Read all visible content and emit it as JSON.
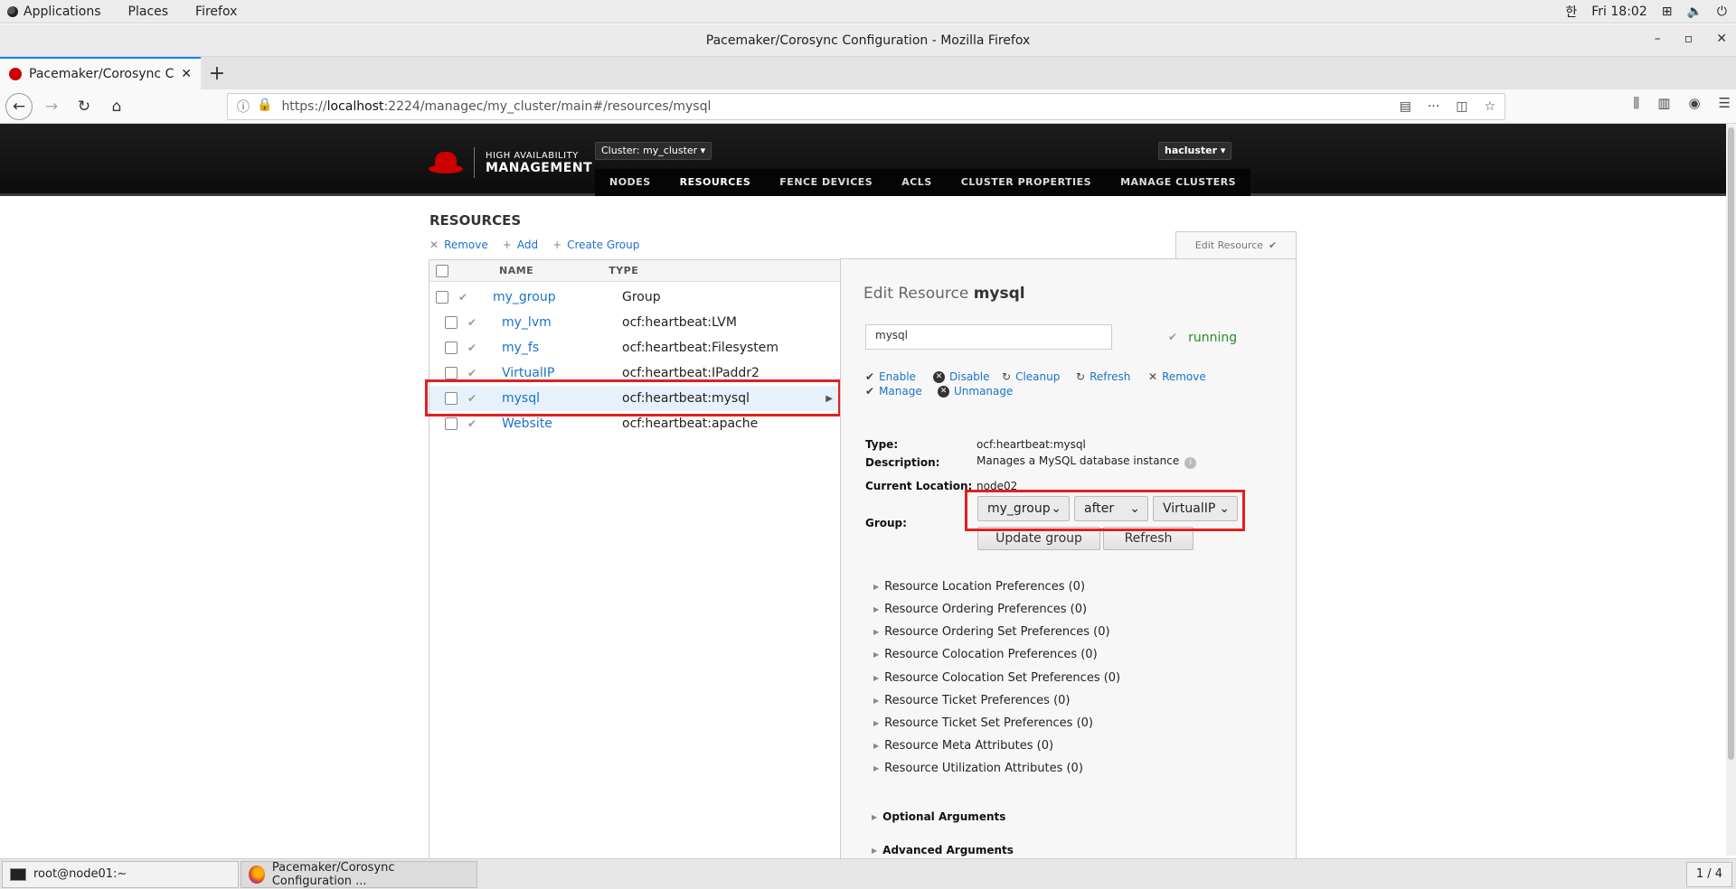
{
  "gnome": {
    "applications": "Applications",
    "places": "Places",
    "firefox": "Firefox",
    "input_method": "한",
    "clock": "Fri 18:02"
  },
  "window": {
    "title": "Pacemaker/Corosync Configuration - Mozilla Firefox"
  },
  "tab": {
    "title": "Pacemaker/Corosync Con",
    "new_tab": "+"
  },
  "urlbar": {
    "prefix": "https://",
    "host": "localhost",
    "rest": ":2224/managec/my_cluster/main#/resources/mysql"
  },
  "header": {
    "logo_line1": "HIGH AVAILABILITY",
    "logo_line2": "MANAGEMENT",
    "cluster_dropdown": "Cluster: my_cluster ▾",
    "user_dropdown": "hacluster ▾",
    "nav": [
      {
        "label": "NODES"
      },
      {
        "label": "RESOURCES"
      },
      {
        "label": "FENCE DEVICES"
      },
      {
        "label": "ACLS"
      },
      {
        "label": "CLUSTER PROPERTIES"
      },
      {
        "label": "MANAGE CLUSTERS"
      }
    ]
  },
  "resources": {
    "heading": "RESOURCES",
    "actions": {
      "remove": "Remove",
      "add": "Add",
      "create_group": "Create Group"
    },
    "columns": {
      "name": "NAME",
      "type": "TYPE"
    },
    "rows": [
      {
        "name": "my_group",
        "type": "Group"
      },
      {
        "name": "my_lvm",
        "type": "ocf:heartbeat:LVM"
      },
      {
        "name": "my_fs",
        "type": "ocf:heartbeat:Filesystem"
      },
      {
        "name": "VirtualIP",
        "type": "ocf:heartbeat:IPaddr2"
      },
      {
        "name": "mysql",
        "type": "ocf:heartbeat:mysql"
      },
      {
        "name": "Website",
        "type": "ocf:heartbeat:apache"
      }
    ]
  },
  "edit": {
    "tab_label": "Edit Resource",
    "title_prefix": "Edit Resource",
    "title_name": "mysql",
    "name_value": "mysql",
    "status": "running",
    "actions": {
      "enable": "Enable",
      "disable": "Disable",
      "cleanup": "Cleanup",
      "refresh": "Refresh",
      "remove": "Remove",
      "manage": "Manage",
      "unmanage": "Unmanage"
    },
    "details": {
      "type_label": "Type:",
      "type_value": "ocf:heartbeat:mysql",
      "desc_label": "Description:",
      "desc_value": "Manages a MySQL database instance",
      "loc_label": "Current Location:",
      "loc_value": "node02",
      "group_label": "Group:"
    },
    "group": {
      "group_select": "my_group",
      "position_select": "after",
      "target_select": "VirtualIP",
      "update_button": "Update group",
      "refresh_button": "Refresh"
    },
    "preferences": [
      "Resource Location Preferences (0)",
      "Resource Ordering Preferences (0)",
      "Resource Ordering Set Preferences (0)",
      "Resource Colocation Preferences (0)",
      "Resource Colocation Set Preferences (0)",
      "Resource Ticket Preferences (0)",
      "Resource Ticket Set Preferences (0)",
      "Resource Meta Attributes (0)",
      "Resource Utilization Attributes (0)"
    ],
    "optional_args": "Optional Arguments",
    "advanced_args": "Advanced Arguments"
  },
  "taskbar": {
    "terminal": "root@node01:~",
    "firefox": "Pacemaker/Corosync Configuration ...",
    "workspace": "1 / 4"
  }
}
